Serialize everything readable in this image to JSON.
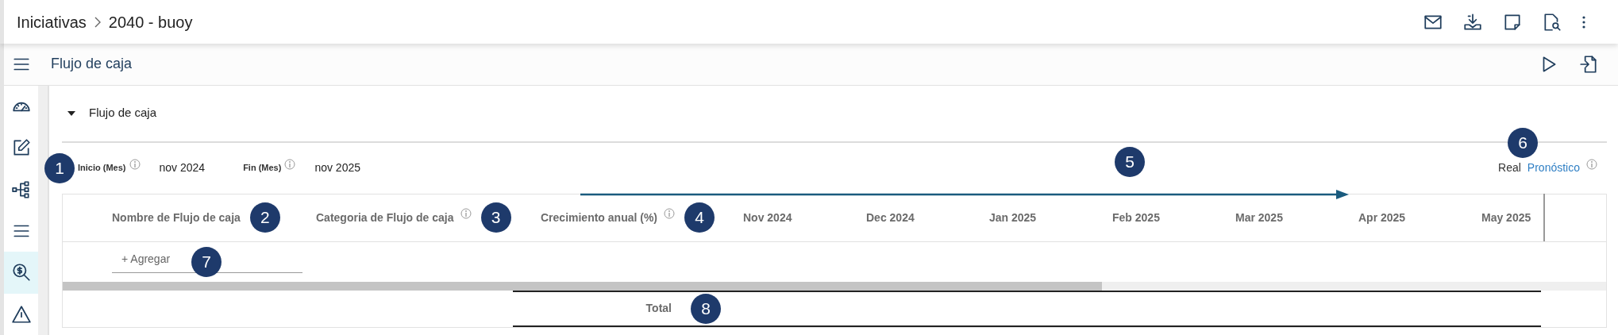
{
  "breadcrumb": [
    {
      "label": "Iniciativas"
    },
    {
      "label": "2040 - buoy"
    }
  ],
  "page_title": "Flujo de caja",
  "sidebar": {
    "items": [
      {
        "kind": "gauge",
        "selected": false
      },
      {
        "kind": "edit",
        "selected": false
      },
      {
        "kind": "hierarchy",
        "selected": false
      },
      {
        "kind": "list",
        "selected": false
      },
      {
        "kind": "money-search",
        "selected": true
      },
      {
        "kind": "warning",
        "selected": false
      }
    ]
  },
  "section": {
    "title": "Flujo de caja",
    "expanded": true
  },
  "filters": [
    {
      "label": "Inicio (Mes)",
      "info": true,
      "value": "nov 2024",
      "marker": "1"
    },
    {
      "label": "Fin (Mes)",
      "info": true,
      "value": "nov 2025"
    }
  ],
  "timeline_marker": "5",
  "legend": {
    "items": [
      {
        "label": "Real",
        "selected": false
      },
      {
        "label": "Pronóstico",
        "selected": true
      }
    ],
    "info": true,
    "marker": "6"
  },
  "table": {
    "columns": [
      {
        "label": "Nombre de Flujo de caja",
        "info": false,
        "marker": "2"
      },
      {
        "label": "Categoria de Flujo de caja",
        "info": true,
        "marker": "3"
      },
      {
        "label": "Crecimiento anual (%)",
        "info": true,
        "marker": "4"
      }
    ],
    "months": [
      "Nov 2024",
      "Dec 2024",
      "Jan 2025",
      "Feb 2025",
      "Mar 2025",
      "Apr 2025",
      "May 2025"
    ],
    "add_button": {
      "label": "+ Agregar",
      "marker": "7"
    },
    "total": {
      "label": "Total",
      "marker": "8"
    }
  }
}
